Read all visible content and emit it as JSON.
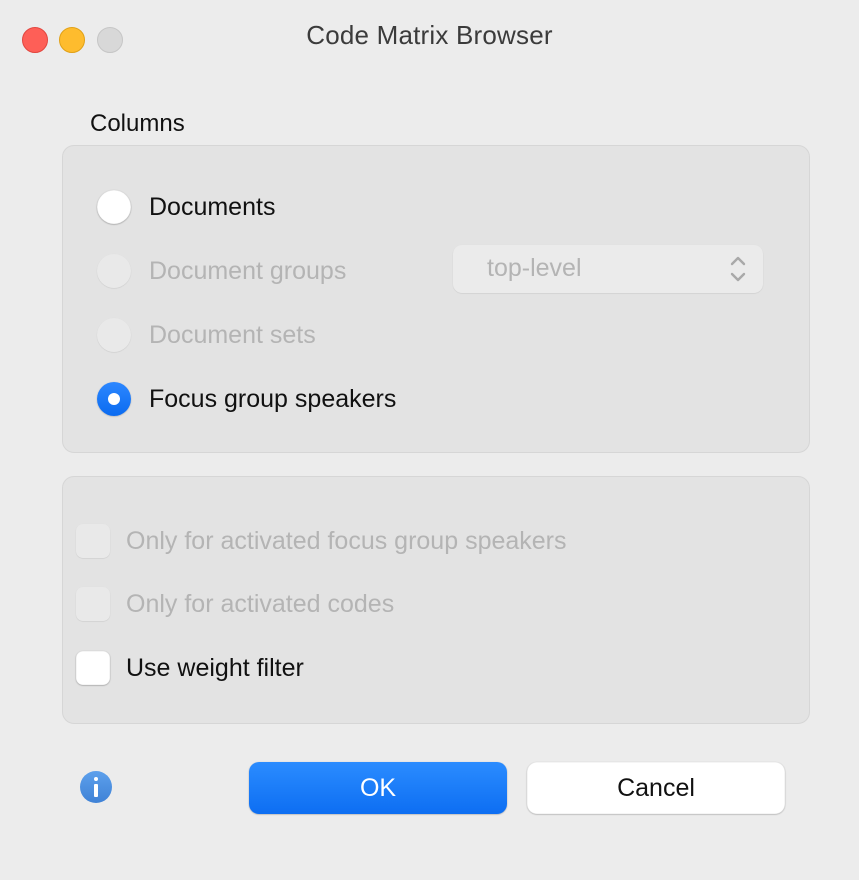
{
  "window": {
    "title": "Code Matrix Browser"
  },
  "columns": {
    "label": "Columns",
    "options": [
      {
        "label": "Documents",
        "state": "unselected",
        "enabled": true
      },
      {
        "label": "Document groups",
        "state": "unselected",
        "enabled": false
      },
      {
        "label": "Document sets",
        "state": "unselected",
        "enabled": false
      },
      {
        "label": "Focus group speakers",
        "state": "selected",
        "enabled": true
      }
    ],
    "group_level_select": {
      "value": "top-level",
      "enabled": false,
      "icon": "up-down-chevron-icon"
    }
  },
  "options": {
    "checkboxes": [
      {
        "label": "Only for activated focus group speakers",
        "checked": false,
        "enabled": false
      },
      {
        "label": "Only for activated codes",
        "checked": false,
        "enabled": false
      },
      {
        "label": "Use weight filter",
        "checked": false,
        "enabled": true
      }
    ]
  },
  "footer": {
    "info_icon": "info-icon",
    "ok_label": "OK",
    "cancel_label": "Cancel"
  },
  "colors": {
    "accent": "#0b6bf0",
    "close": "#fe5f57",
    "minimize": "#febc2e",
    "maximize_disabled": "#d8d8d8",
    "info": "#4a8fe0",
    "disabled_text": "#b4b4b4"
  }
}
